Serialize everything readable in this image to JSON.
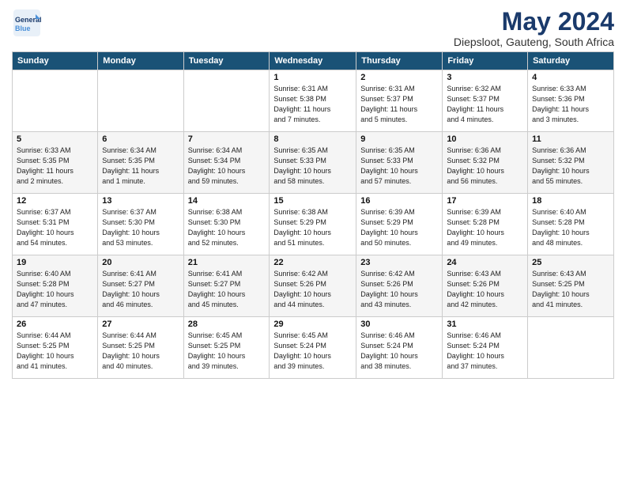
{
  "header": {
    "logo_line1": "General",
    "logo_line2": "Blue",
    "title": "May 2024",
    "subtitle": "Diepsloot, Gauteng, South Africa"
  },
  "weekdays": [
    "Sunday",
    "Monday",
    "Tuesday",
    "Wednesday",
    "Thursday",
    "Friday",
    "Saturday"
  ],
  "weeks": [
    [
      {
        "day": "",
        "info": ""
      },
      {
        "day": "",
        "info": ""
      },
      {
        "day": "",
        "info": ""
      },
      {
        "day": "1",
        "info": "Sunrise: 6:31 AM\nSunset: 5:38 PM\nDaylight: 11 hours\nand 7 minutes."
      },
      {
        "day": "2",
        "info": "Sunrise: 6:31 AM\nSunset: 5:37 PM\nDaylight: 11 hours\nand 5 minutes."
      },
      {
        "day": "3",
        "info": "Sunrise: 6:32 AM\nSunset: 5:37 PM\nDaylight: 11 hours\nand 4 minutes."
      },
      {
        "day": "4",
        "info": "Sunrise: 6:33 AM\nSunset: 5:36 PM\nDaylight: 11 hours\nand 3 minutes."
      }
    ],
    [
      {
        "day": "5",
        "info": "Sunrise: 6:33 AM\nSunset: 5:35 PM\nDaylight: 11 hours\nand 2 minutes."
      },
      {
        "day": "6",
        "info": "Sunrise: 6:34 AM\nSunset: 5:35 PM\nDaylight: 11 hours\nand 1 minute."
      },
      {
        "day": "7",
        "info": "Sunrise: 6:34 AM\nSunset: 5:34 PM\nDaylight: 10 hours\nand 59 minutes."
      },
      {
        "day": "8",
        "info": "Sunrise: 6:35 AM\nSunset: 5:33 PM\nDaylight: 10 hours\nand 58 minutes."
      },
      {
        "day": "9",
        "info": "Sunrise: 6:35 AM\nSunset: 5:33 PM\nDaylight: 10 hours\nand 57 minutes."
      },
      {
        "day": "10",
        "info": "Sunrise: 6:36 AM\nSunset: 5:32 PM\nDaylight: 10 hours\nand 56 minutes."
      },
      {
        "day": "11",
        "info": "Sunrise: 6:36 AM\nSunset: 5:32 PM\nDaylight: 10 hours\nand 55 minutes."
      }
    ],
    [
      {
        "day": "12",
        "info": "Sunrise: 6:37 AM\nSunset: 5:31 PM\nDaylight: 10 hours\nand 54 minutes."
      },
      {
        "day": "13",
        "info": "Sunrise: 6:37 AM\nSunset: 5:30 PM\nDaylight: 10 hours\nand 53 minutes."
      },
      {
        "day": "14",
        "info": "Sunrise: 6:38 AM\nSunset: 5:30 PM\nDaylight: 10 hours\nand 52 minutes."
      },
      {
        "day": "15",
        "info": "Sunrise: 6:38 AM\nSunset: 5:29 PM\nDaylight: 10 hours\nand 51 minutes."
      },
      {
        "day": "16",
        "info": "Sunrise: 6:39 AM\nSunset: 5:29 PM\nDaylight: 10 hours\nand 50 minutes."
      },
      {
        "day": "17",
        "info": "Sunrise: 6:39 AM\nSunset: 5:28 PM\nDaylight: 10 hours\nand 49 minutes."
      },
      {
        "day": "18",
        "info": "Sunrise: 6:40 AM\nSunset: 5:28 PM\nDaylight: 10 hours\nand 48 minutes."
      }
    ],
    [
      {
        "day": "19",
        "info": "Sunrise: 6:40 AM\nSunset: 5:28 PM\nDaylight: 10 hours\nand 47 minutes."
      },
      {
        "day": "20",
        "info": "Sunrise: 6:41 AM\nSunset: 5:27 PM\nDaylight: 10 hours\nand 46 minutes."
      },
      {
        "day": "21",
        "info": "Sunrise: 6:41 AM\nSunset: 5:27 PM\nDaylight: 10 hours\nand 45 minutes."
      },
      {
        "day": "22",
        "info": "Sunrise: 6:42 AM\nSunset: 5:26 PM\nDaylight: 10 hours\nand 44 minutes."
      },
      {
        "day": "23",
        "info": "Sunrise: 6:42 AM\nSunset: 5:26 PM\nDaylight: 10 hours\nand 43 minutes."
      },
      {
        "day": "24",
        "info": "Sunrise: 6:43 AM\nSunset: 5:26 PM\nDaylight: 10 hours\nand 42 minutes."
      },
      {
        "day": "25",
        "info": "Sunrise: 6:43 AM\nSunset: 5:25 PM\nDaylight: 10 hours\nand 41 minutes."
      }
    ],
    [
      {
        "day": "26",
        "info": "Sunrise: 6:44 AM\nSunset: 5:25 PM\nDaylight: 10 hours\nand 41 minutes."
      },
      {
        "day": "27",
        "info": "Sunrise: 6:44 AM\nSunset: 5:25 PM\nDaylight: 10 hours\nand 40 minutes."
      },
      {
        "day": "28",
        "info": "Sunrise: 6:45 AM\nSunset: 5:25 PM\nDaylight: 10 hours\nand 39 minutes."
      },
      {
        "day": "29",
        "info": "Sunrise: 6:45 AM\nSunset: 5:24 PM\nDaylight: 10 hours\nand 39 minutes."
      },
      {
        "day": "30",
        "info": "Sunrise: 6:46 AM\nSunset: 5:24 PM\nDaylight: 10 hours\nand 38 minutes."
      },
      {
        "day": "31",
        "info": "Sunrise: 6:46 AM\nSunset: 5:24 PM\nDaylight: 10 hours\nand 37 minutes."
      },
      {
        "day": "",
        "info": ""
      }
    ]
  ]
}
